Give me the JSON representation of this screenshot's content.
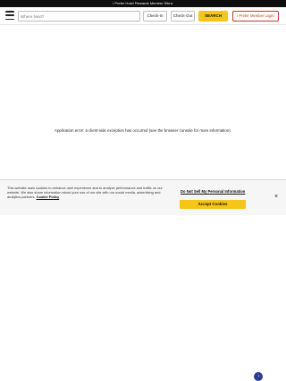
{
  "topbar": {
    "text": "i Prefer Hotel Rewards Member Site ▸"
  },
  "header": {
    "search_placeholder": "Where Next?",
    "checkin_label": "Check-In",
    "checkout_label": "Check-Out",
    "search_button": "SEARCH",
    "login_button": "i Prefer Member Login"
  },
  "main": {
    "error_message": "Application error: a client-side exception has occurred (see the browser console for more information)."
  },
  "cookie_banner": {
    "text": "This website uses cookies to enhance user experience and to analyze performance and traffic on our website. We also share information about your use of our site with our social media, advertising and analytics partners.",
    "policy_link": "Cookie Policy",
    "do_not_sell": "Do Not Sell My Personal Information",
    "accept_button": "Accept Cookies",
    "close": "×"
  },
  "colors": {
    "accent": "#f5c518",
    "login": "#c0392b",
    "topbar": "#0d0d0d"
  }
}
